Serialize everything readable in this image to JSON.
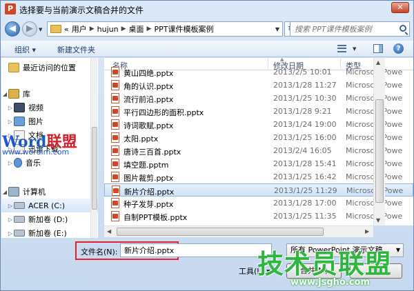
{
  "window": {
    "title": "选择要与当前演示文稿合并的文件",
    "app_icon_letter": "P",
    "close_glyph": "✕"
  },
  "address": {
    "back_glyph": "◀",
    "forward_glyph": "▶",
    "overflow_glyph": "«",
    "crumbs": [
      "用户",
      "hujun",
      "桌面",
      "PPT课件模板案例"
    ],
    "refresh_glyph": "↻",
    "search_placeholder": "搜索 PPT课件模板案例"
  },
  "toolbar": {
    "organize_label": "组织 ▾",
    "new_folder_label": "新建文件夹",
    "help_glyph": "?"
  },
  "nav": {
    "items": [
      {
        "label": "最近访问的位置",
        "icon": "recent-places-icon"
      },
      {
        "label": "库",
        "icon": "library-icon"
      },
      {
        "label": "视频",
        "icon": "video-icon"
      },
      {
        "label": "图片",
        "icon": "pictures-icon"
      },
      {
        "label": "文档",
        "icon": "documents-icon"
      },
      {
        "label": "迅雷下载",
        "icon": "download-icon"
      },
      {
        "label": "音乐",
        "icon": "music-icon"
      },
      {
        "label": "计算机",
        "icon": "computer-icon"
      },
      {
        "label": "ACER (C:)",
        "icon": "drive-icon"
      },
      {
        "label": "新加卷 (D:)",
        "icon": "drive-icon"
      },
      {
        "label": "新加卷 (E:)",
        "icon": "drive-icon"
      }
    ],
    "watermark_a": "Word",
    "watermark_b": "联盟",
    "watermark_url": "www.wordlm.com"
  },
  "list": {
    "headers": {
      "name": "名称",
      "date": "修改日期",
      "type": "类型"
    },
    "rows": [
      {
        "name": "黄山四绝.pptx",
        "date": "2013/2/5 10:01",
        "type": "Microsoft Powe"
      },
      {
        "name": "角的认识.pptx",
        "date": "2013/1/28 11:27",
        "type": "Microsoft Powe"
      },
      {
        "name": "流行前沿.pptx",
        "date": "2013/1/25 10:30",
        "type": "Microsoft Powe"
      },
      {
        "name": "平行四边形的面积.pptx",
        "date": "2013/1/28 9:21",
        "type": "Microsoft Powe"
      },
      {
        "name": "诗词歌赋.pptx",
        "date": "2013/1/24 19:00",
        "type": "Microsoft Powe"
      },
      {
        "name": "太阳.pptx",
        "date": "2013/1/25 16:00",
        "type": "Microsoft Powe"
      },
      {
        "name": "唐诗三百首.pptx",
        "date": "2013/2/4 16:05",
        "type": "Microsoft Powe"
      },
      {
        "name": "填空题.pptm",
        "date": "2013/1/28 15:41",
        "type": "Microsoft Powe"
      },
      {
        "name": "图片裁剪.pptx",
        "date": "2013/1/25 16:42",
        "type": "Microsoft Powe"
      },
      {
        "name": "新片介绍.pptx",
        "date": "2013/1/25 11:29",
        "type": "Microsoft Powe"
      },
      {
        "name": "种子发芽.pptx",
        "date": "2013/1/28 17:00",
        "type": "Microsoft Powe"
      },
      {
        "name": "自制PPT模板.pptx",
        "date": "2013/1/25 11:35",
        "type": "Microsoft Powe"
      }
    ],
    "selected_index": 9
  },
  "bottom": {
    "filename_label": "文件名(N):",
    "filename_value": "新片介绍.pptx",
    "filter_value": "所有 PowerPoint 演示文稿",
    "tools_label": "工具(L) ▾",
    "merge_label": "合并(M)",
    "cancel_label": "取消"
  },
  "brand": {
    "text": "技术员联盟",
    "url": "www.jsgho.com"
  },
  "colors": {
    "highlight_border": "#e0212b",
    "selection": "#cfe2f8",
    "brand_green": "#2fb63e"
  }
}
